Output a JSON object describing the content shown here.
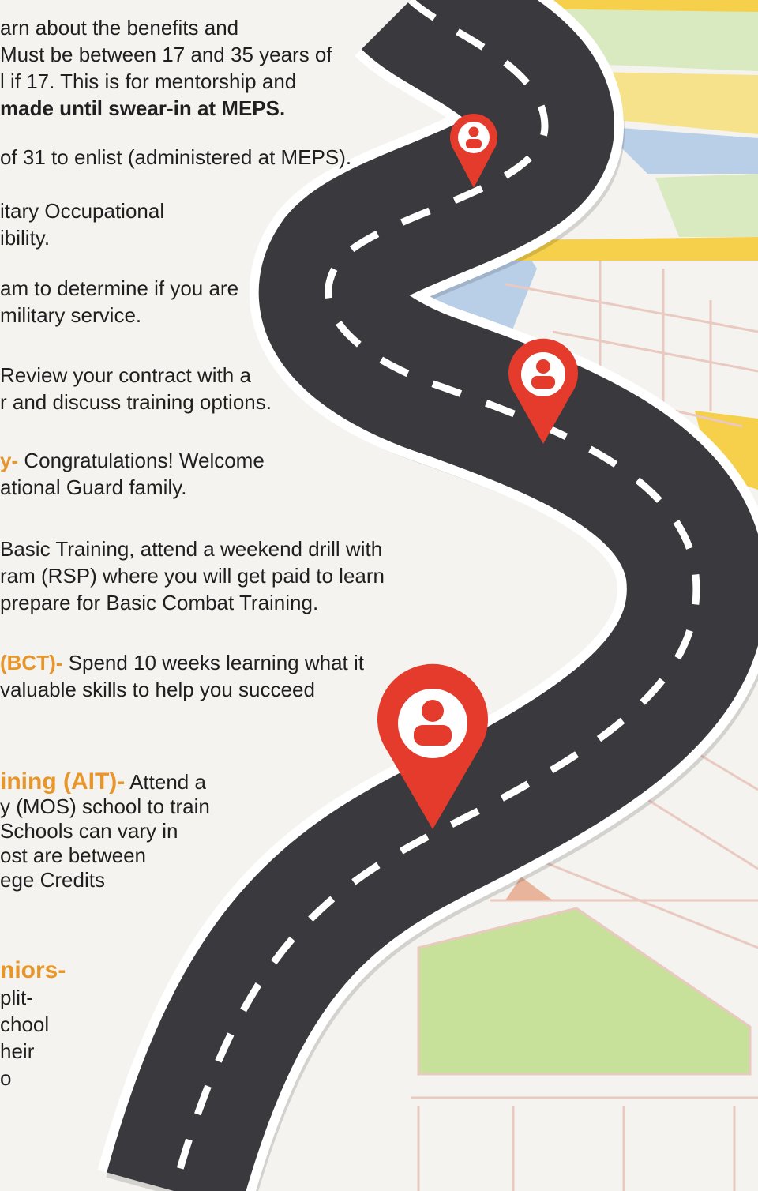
{
  "steps": [
    {
      "lines": [
        "arn about the benefits and",
        "Must be between 17 and 35 years of",
        "l if 17. This is for mentorship and"
      ],
      "bold_line": "made until swear-in at MEPS."
    },
    {
      "lines": [
        "of 31 to enlist (administered at MEPS)."
      ]
    },
    {
      "lines": [
        "itary Occupational",
        "ibility."
      ]
    },
    {
      "lines": [
        "am to determine if you are",
        "military service."
      ]
    },
    {
      "lines": [
        "Review your contract with a",
        "r and discuss training options."
      ]
    },
    {
      "heading": "y-",
      "first_line_text": " Congratulations! Welcome",
      "lines": [
        "ational Guard family."
      ]
    },
    {
      "lines": [
        "Basic Training, attend a weekend drill with",
        "ram (RSP) where you will get paid to learn",
        " prepare for Basic Combat Training."
      ]
    },
    {
      "heading": "(BCT)-",
      "first_line_text": " Spend 10 weeks learning what it",
      "lines": [
        "valuable skills to help you succeed"
      ]
    },
    {
      "heading": "ining (AIT)-",
      "first_line_text": " Attend a",
      "lines": [
        "y (MOS) school to train",
        " Schools can vary in",
        "ost are between",
        "ege Credits"
      ]
    },
    {
      "heading": "niors-",
      "lines": [
        "plit-",
        "chool",
        "heir",
        "",
        "o"
      ]
    }
  ],
  "icons": [
    "map-pin-person-icon",
    "map-pin-person-icon",
    "map-pin-person-icon"
  ],
  "colors": {
    "accent_orange": "#e8962a",
    "pin_red": "#e53b2c",
    "road_dark": "#3a3a3e",
    "road_dash": "#ffffff"
  }
}
